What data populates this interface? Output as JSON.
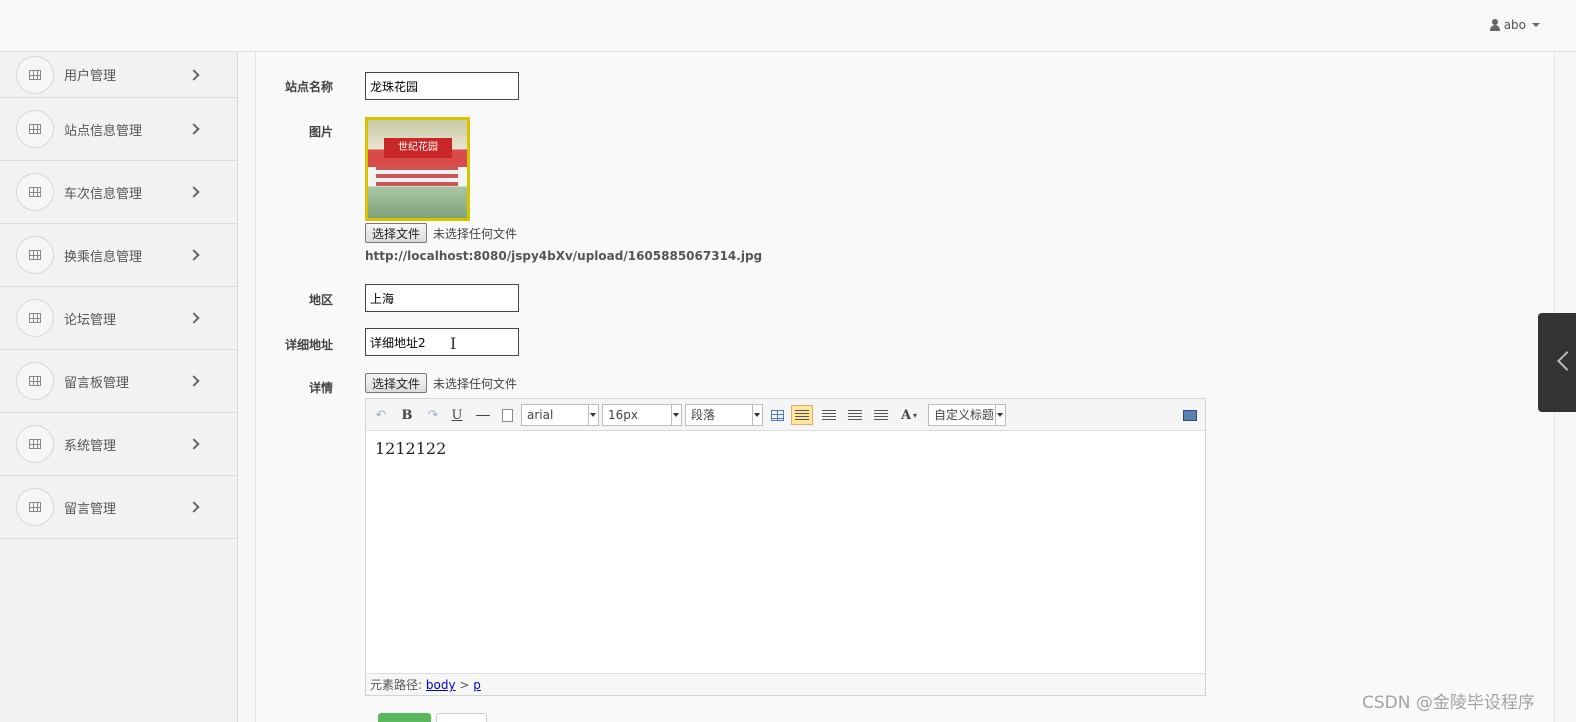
{
  "header": {
    "username": "abo"
  },
  "sidebar": {
    "items": [
      {
        "label": "用户管理"
      },
      {
        "label": "站点信息管理"
      },
      {
        "label": "车次信息管理"
      },
      {
        "label": "换乘信息管理"
      },
      {
        "label": "论坛管理"
      },
      {
        "label": "留言板管理"
      },
      {
        "label": "系统管理"
      },
      {
        "label": "留言管理"
      }
    ]
  },
  "form": {
    "station_name_label": "站点名称",
    "station_name_value": "龙珠花园",
    "image_label": "图片",
    "image_sign_text": "世纪花园",
    "file_button_label": "选择文件",
    "no_file_text": "未选择任何文件",
    "image_url": "http://localhost:8080/jspy4bXv/upload/1605885067314.jpg",
    "region_label": "地区",
    "region_value": "上海",
    "address_label": "详细地址",
    "address_value": "详细地址2",
    "details_label": "详情",
    "details_file_button_label": "选择文件",
    "details_no_file_text": "未选择任何文件"
  },
  "editor": {
    "font_family": "arial",
    "font_size": "16px",
    "paragraph": "段落",
    "custom_title": "自定义标题",
    "content": "1212122",
    "path_label": "元素路径:",
    "path_body": "body",
    "path_sep": ">",
    "path_p": "p"
  },
  "watermark": "CSDN @金陵毕设程序"
}
